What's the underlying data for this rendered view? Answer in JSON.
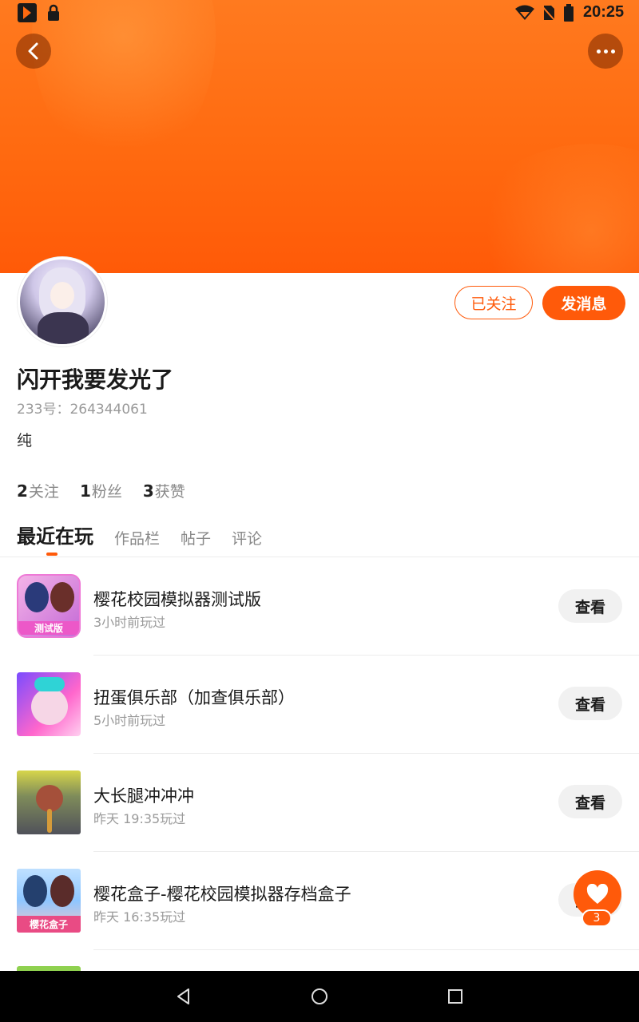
{
  "status_bar": {
    "time": "20:25"
  },
  "profile": {
    "username": "闪开我要发光了",
    "uid_text": "233号：264344061",
    "bio": "纯",
    "follow_button": "已关注",
    "message_button": "发消息"
  },
  "stats": [
    {
      "count": "2",
      "label": "关注"
    },
    {
      "count": "1",
      "label": "粉丝"
    },
    {
      "count": "3",
      "label": "获赞"
    }
  ],
  "tabs": [
    {
      "label": "最近在玩",
      "active": true
    },
    {
      "label": "作品栏"
    },
    {
      "label": "帖子"
    },
    {
      "label": "评论"
    }
  ],
  "games": [
    {
      "title": "樱花校园模拟器测试版",
      "time": "3小时前玩过",
      "button": "查看",
      "icon_label": "测试版"
    },
    {
      "title": "扭蛋俱乐部（加查俱乐部）",
      "time": "5小时前玩过",
      "button": "查看"
    },
    {
      "title": "大长腿冲冲冲",
      "time": "昨天 19:35玩过",
      "button": "查看"
    },
    {
      "title": "樱花盒子-樱花校园模拟器存档盒子",
      "time": "昨天 16:35玩过",
      "button": "查看",
      "icon_label": "樱花盒子"
    }
  ],
  "like_fab": {
    "count": "3"
  },
  "colors": {
    "accent": "#ff5a0a",
    "banner": "#ff6a10"
  }
}
